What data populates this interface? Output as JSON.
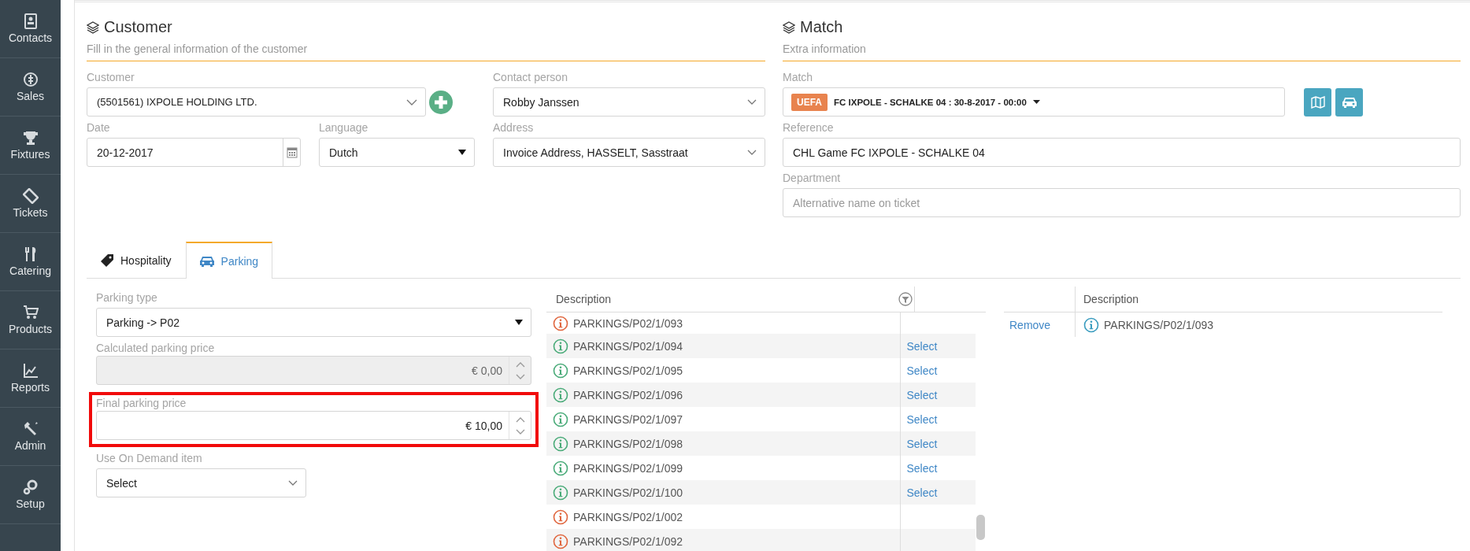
{
  "sidebar": {
    "items": [
      {
        "label": "Contacts"
      },
      {
        "label": "Sales"
      },
      {
        "label": "Fixtures"
      },
      {
        "label": "Tickets"
      },
      {
        "label": "Catering"
      },
      {
        "label": "Products"
      },
      {
        "label": "Reports"
      },
      {
        "label": "Admin"
      },
      {
        "label": "Setup"
      }
    ]
  },
  "customer_section": {
    "title": "Customer",
    "subtitle": "Fill in the general information of the customer",
    "customer": {
      "label": "Customer",
      "value": "(5501561) IXPOLE HOLDING LTD."
    },
    "contact_person": {
      "label": "Contact person",
      "value": "Robby Janssen"
    },
    "date": {
      "label": "Date",
      "value": "20-12-2017"
    },
    "language": {
      "label": "Language",
      "value": "Dutch"
    },
    "address": {
      "label": "Address",
      "value": "Invoice Address, HASSELT, Sasstraat"
    }
  },
  "match_section": {
    "title": "Match",
    "subtitle": "Extra information",
    "match": {
      "label": "Match",
      "badge": "UEFA",
      "value": "FC IXPOLE - SCHALKE 04 : 30-8-2017 - 00:00"
    },
    "reference": {
      "label": "Reference",
      "value": "CHL Game FC IXPOLE - SCHALKE 04"
    },
    "department": {
      "label": "Department",
      "placeholder": "Alternative name on ticket"
    }
  },
  "tabs": [
    {
      "label": "Hospitality",
      "selected": false
    },
    {
      "label": "Parking",
      "selected": true
    }
  ],
  "parking_form": {
    "parking_type": {
      "label": "Parking type",
      "value": "Parking -> P02"
    },
    "prices": [
      {
        "label": "Calculated parking price",
        "value": "€ 0,00",
        "disabled": true,
        "highlighted": false
      },
      {
        "label": "Final parking price",
        "value": "€ 10,00",
        "disabled": false,
        "highlighted": true
      }
    ],
    "on_demand_item": {
      "label": "Use On Demand item",
      "value": "Select"
    }
  },
  "available_table": {
    "heading": "Description",
    "rows": [
      {
        "description": "PARKINGS/P02/1/093",
        "available": false
      },
      {
        "description": "PARKINGS/P02/1/094",
        "available": true,
        "action": "Select"
      },
      {
        "description": "PARKINGS/P02/1/095",
        "available": true,
        "action": "Select"
      },
      {
        "description": "PARKINGS/P02/1/096",
        "available": true,
        "action": "Select"
      },
      {
        "description": "PARKINGS/P02/1/097",
        "available": true,
        "action": "Select"
      },
      {
        "description": "PARKINGS/P02/1/098",
        "available": true,
        "action": "Select"
      },
      {
        "description": "PARKINGS/P02/1/099",
        "available": true,
        "action": "Select"
      },
      {
        "description": "PARKINGS/P02/1/100",
        "available": true,
        "action": "Select"
      },
      {
        "description": "PARKINGS/P02/1/002",
        "available": false
      },
      {
        "description": "PARKINGS/P02/1/092",
        "available": false
      }
    ]
  },
  "selected_table": {
    "heading": "Description",
    "rows": [
      {
        "action": "Remove",
        "description": "PARKINGS/P02/1/093"
      }
    ]
  }
}
